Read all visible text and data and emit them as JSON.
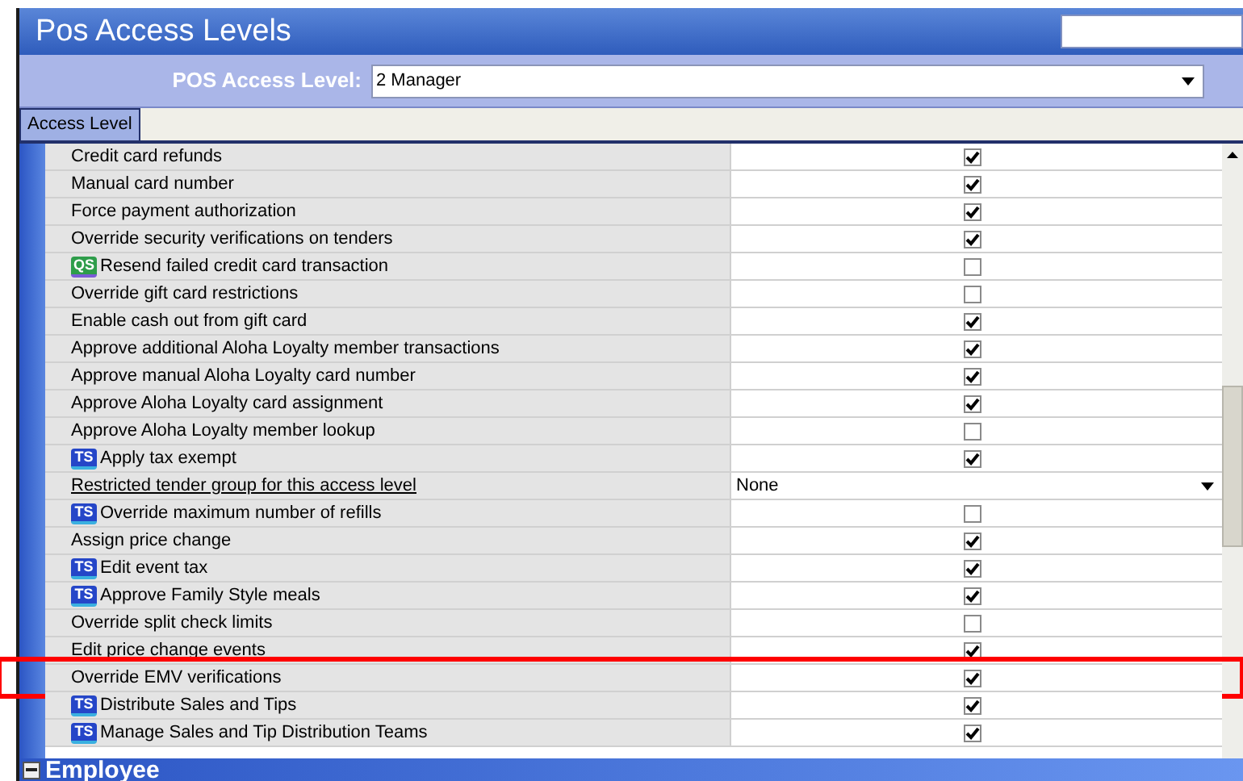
{
  "window": {
    "title": "Pos Access Levels"
  },
  "filter": {
    "label": "POS Access Level:",
    "value": "2 Manager"
  },
  "tabs": [
    {
      "label": "Access Level",
      "selected": true
    }
  ],
  "rows": [
    {
      "kind": "checkbox",
      "label": "Credit card refunds",
      "checked": true,
      "highlighted": false
    },
    {
      "kind": "checkbox",
      "label": "Manual card number",
      "checked": true,
      "highlighted": false
    },
    {
      "kind": "checkbox",
      "label": "Force payment authorization",
      "checked": true,
      "highlighted": false
    },
    {
      "kind": "checkbox",
      "label": "Override security verifications on tenders",
      "checked": true,
      "highlighted": false
    },
    {
      "kind": "checkbox",
      "label": "Resend failed credit card transaction",
      "badge": "QS",
      "checked": false,
      "highlighted": false
    },
    {
      "kind": "checkbox",
      "label": "Override gift card restrictions",
      "checked": false,
      "highlighted": false
    },
    {
      "kind": "checkbox",
      "label": "Enable cash out from gift card",
      "checked": true,
      "highlighted": false
    },
    {
      "kind": "checkbox",
      "label": "Approve additional Aloha Loyalty member transactions",
      "checked": true,
      "highlighted": false
    },
    {
      "kind": "checkbox",
      "label": "Approve manual Aloha Loyalty card number",
      "checked": true,
      "highlighted": false
    },
    {
      "kind": "checkbox",
      "label": "Approve Aloha Loyalty card assignment",
      "checked": true,
      "highlighted": false
    },
    {
      "kind": "checkbox",
      "label": "Approve Aloha Loyalty member lookup",
      "checked": false,
      "highlighted": false
    },
    {
      "kind": "checkbox",
      "label": "Apply tax exempt",
      "badge": "TS",
      "checked": true,
      "highlighted": false
    },
    {
      "kind": "dropdown",
      "label": "Restricted tender group for this access level",
      "value": "None",
      "highlighted": false
    },
    {
      "kind": "checkbox",
      "label": "Override maximum number of refills",
      "badge": "TS",
      "checked": false,
      "highlighted": false
    },
    {
      "kind": "checkbox",
      "label": "Assign price change",
      "checked": true,
      "highlighted": false
    },
    {
      "kind": "checkbox",
      "label": "Edit event tax",
      "badge": "TS",
      "checked": true,
      "highlighted": false
    },
    {
      "kind": "checkbox",
      "label": "Approve Family Style meals",
      "badge": "TS",
      "checked": true,
      "highlighted": false
    },
    {
      "kind": "checkbox",
      "label": "Override split check limits",
      "checked": false,
      "highlighted": false
    },
    {
      "kind": "checkbox",
      "label": "Edit price change events",
      "checked": true,
      "highlighted": false
    },
    {
      "kind": "checkbox",
      "label": "Override EMV verifications",
      "checked": true,
      "highlighted": true
    },
    {
      "kind": "checkbox",
      "label": "Distribute Sales and Tips",
      "badge": "TS",
      "checked": true,
      "highlighted": false
    },
    {
      "kind": "checkbox",
      "label": "Manage Sales and Tip Distribution Teams",
      "badge": "TS",
      "checked": true,
      "highlighted": false
    }
  ],
  "section": {
    "label": "Employee",
    "expanded": true
  }
}
